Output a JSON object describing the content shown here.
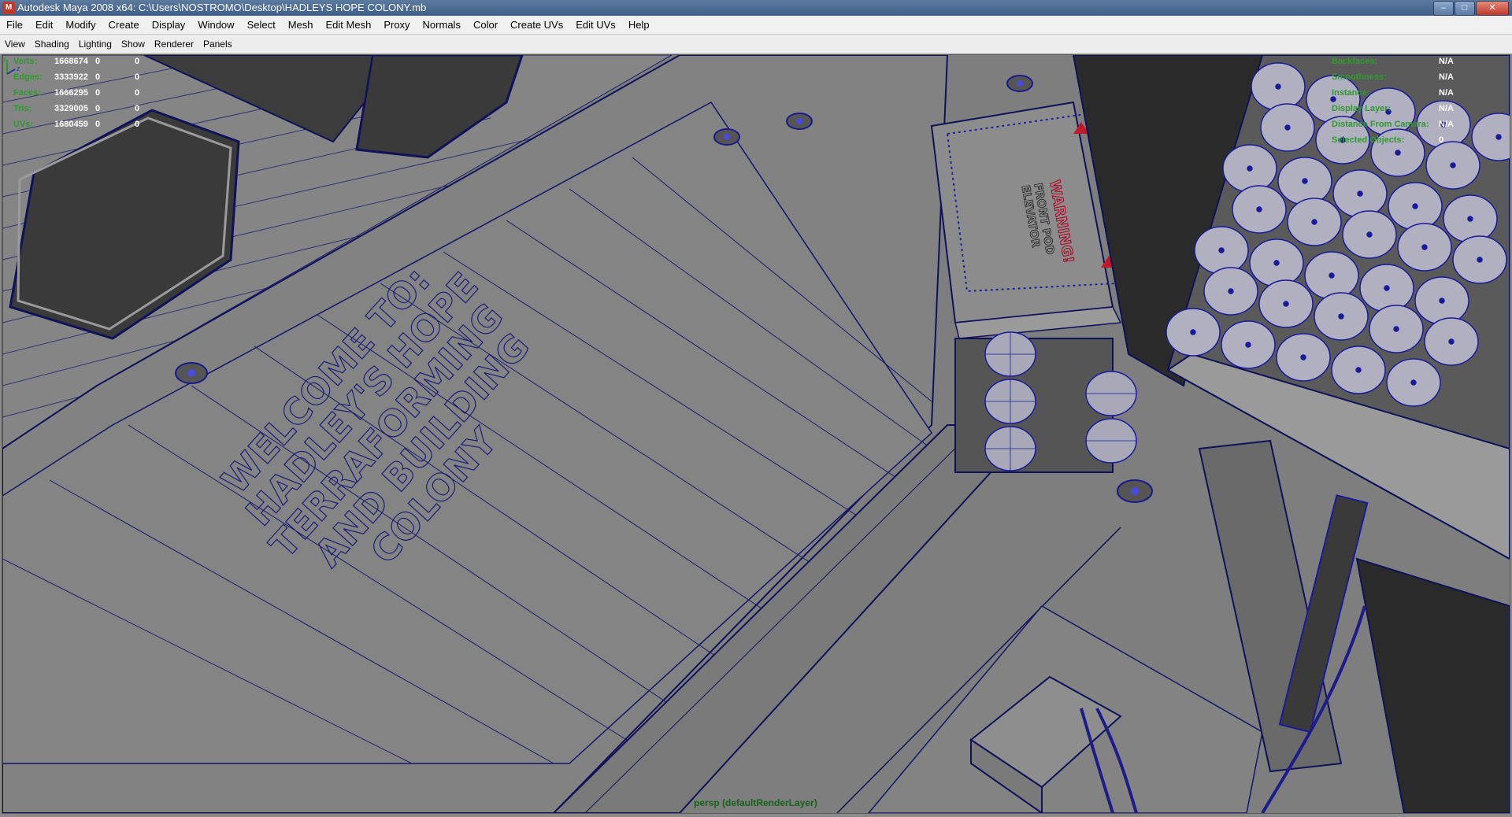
{
  "window": {
    "title": "Autodesk Maya 2008 x64: C:\\Users\\NOSTROMO\\Desktop\\HADLEYS HOPE COLONY.mb",
    "app_icon": "maya-icon",
    "buttons": {
      "minimize": "–",
      "maximize": "□",
      "close": "✕"
    }
  },
  "menubar": {
    "items": [
      "File",
      "Edit",
      "Modify",
      "Create",
      "Display",
      "Window",
      "Select",
      "Mesh",
      "Edit Mesh",
      "Proxy",
      "Normals",
      "Color",
      "Create UVs",
      "Edit UVs",
      "Help"
    ]
  },
  "panel_menu": {
    "items": [
      "View",
      "Shading",
      "Lighting",
      "Show",
      "Renderer",
      "Panels"
    ]
  },
  "hud_left": {
    "rows": [
      {
        "label": "Verts:",
        "value": "1668674",
        "c1": "0",
        "c2": "0"
      },
      {
        "label": "Edges:",
        "value": "3333922",
        "c1": "0",
        "c2": "0"
      },
      {
        "label": "Faces:",
        "value": "1666295",
        "c1": "0",
        "c2": "0"
      },
      {
        "label": "Tris:",
        "value": "3329005",
        "c1": "0",
        "c2": "0"
      },
      {
        "label": "UVs:",
        "value": "1680459",
        "c1": "0",
        "c2": "0"
      }
    ]
  },
  "hud_right": {
    "rows": [
      {
        "label": "Backfaces:",
        "value": "N/A"
      },
      {
        "label": "Smoothness:",
        "value": "N/A"
      },
      {
        "label": "Instance:",
        "value": "N/A"
      },
      {
        "label": "Display Layer:",
        "value": "N/A"
      },
      {
        "label": "Distance From Camera:",
        "value": "N/A"
      },
      {
        "label": "Selected Objects:",
        "value": "0"
      }
    ]
  },
  "viewport": {
    "camera_label": "persp (defaultRenderLayer)",
    "floor_text": [
      "WELCOME TO:",
      "HADLEY'S HOPE",
      "TERRAFORMING",
      "AND BUILDING",
      "COLONY"
    ],
    "sign_text": [
      "WARNING!",
      "FRONT POD",
      "ELEVATOR"
    ],
    "axis_labels": {
      "y": "y",
      "z": "z"
    }
  }
}
